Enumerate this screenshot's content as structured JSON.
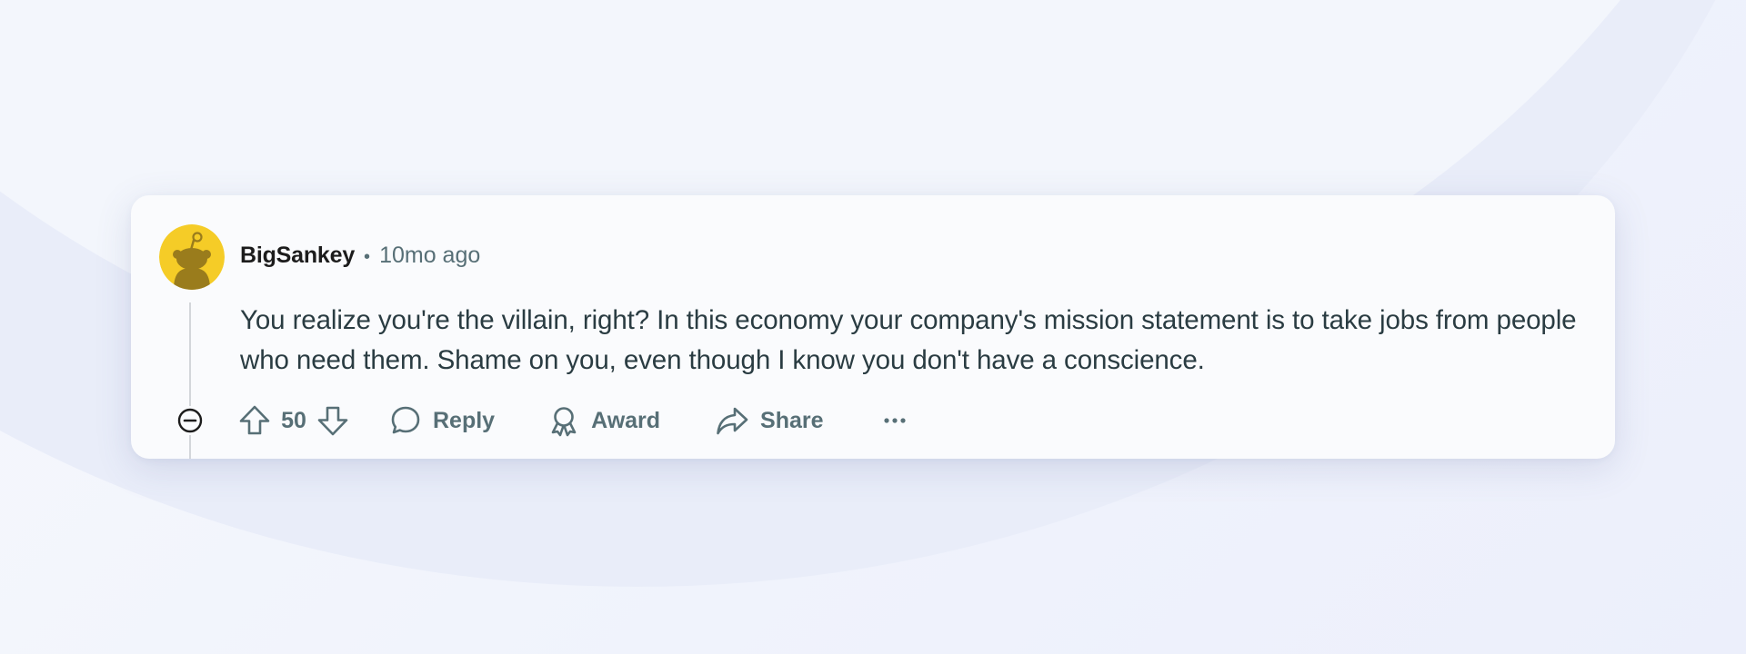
{
  "comment": {
    "author": "BigSankey",
    "separator": "•",
    "timestamp": "10mo ago",
    "body": "You realize you're the villain, right? In this economy your company's mission statement is to take jobs from people who need them. Shame on you, even though I know you don't have a conscience.",
    "score": "50",
    "avatar_color": "#f5cc27"
  },
  "actions": {
    "upvote_icon": "arrow-up-icon",
    "downvote_icon": "arrow-down-icon",
    "collapse_icon": "minus-circle-icon",
    "reply_label": "Reply",
    "reply_icon": "speech-bubble-icon",
    "award_label": "Award",
    "award_icon": "award-ribbon-icon",
    "share_label": "Share",
    "share_icon": "share-arrow-icon",
    "more_label": "···",
    "more_icon": "ellipsis-icon"
  },
  "colors": {
    "text_primary": "#1c1c1c",
    "text_secondary": "#576f76",
    "card_background": "#fafbfd",
    "thread_line": "#d3d6da"
  }
}
